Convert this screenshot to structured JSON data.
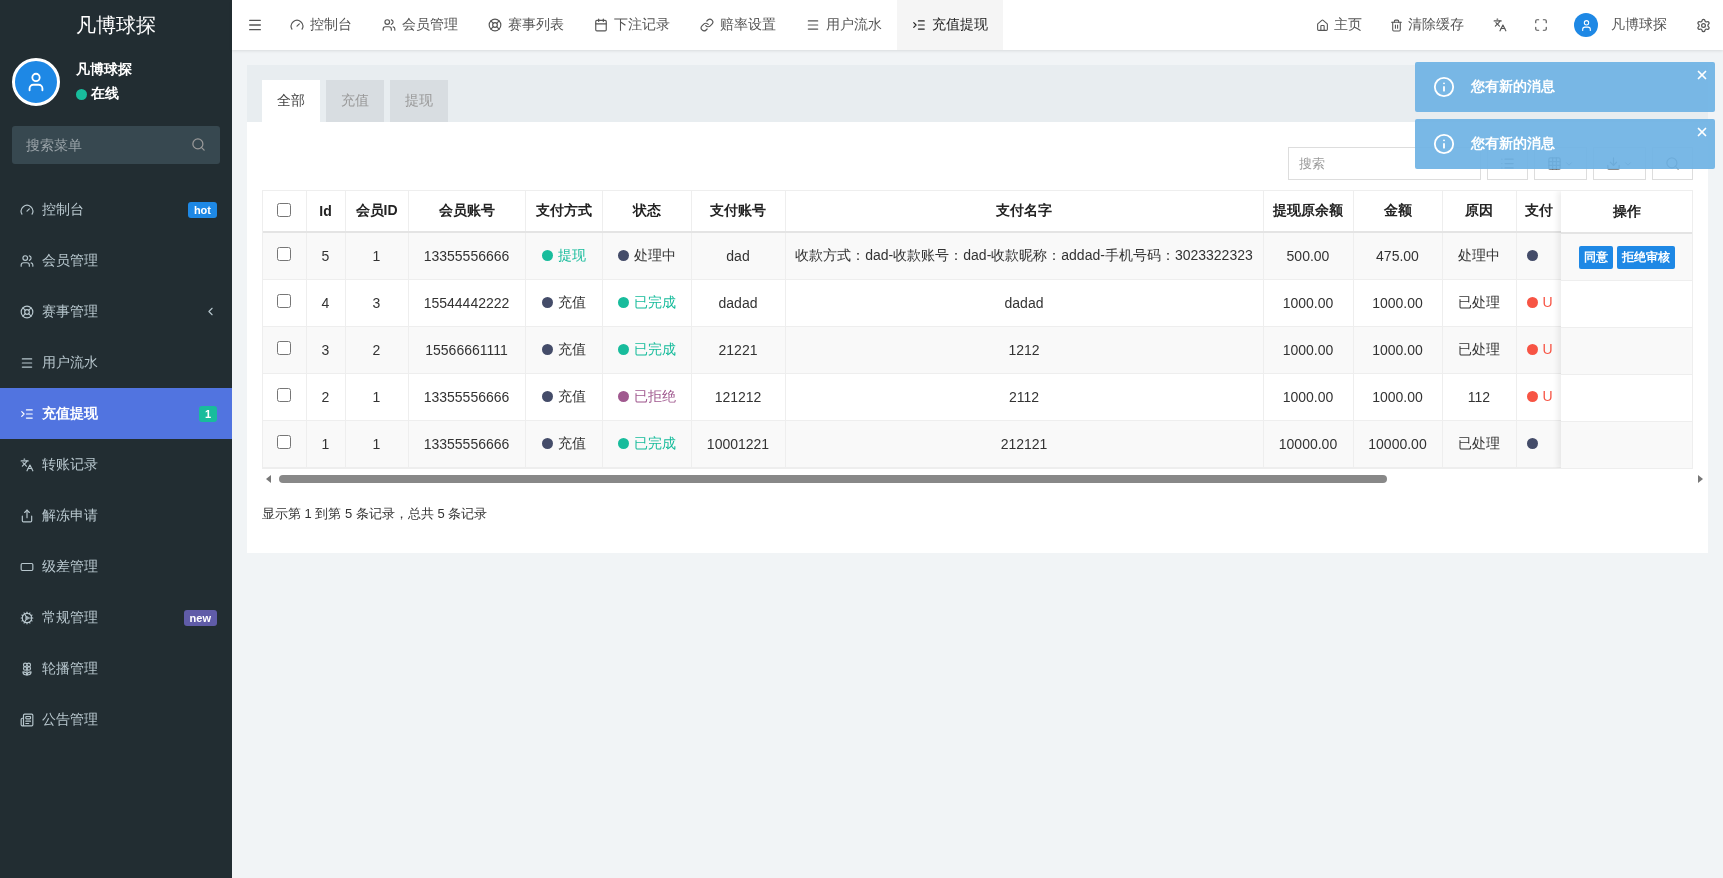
{
  "sidebar": {
    "brand": "凡博球探",
    "user": {
      "name": "凡博球探",
      "status": "在线",
      "online": true
    },
    "search": {
      "placeholder": "搜索菜单"
    },
    "items": [
      {
        "label": "控制台",
        "selected": false,
        "badge": {
          "text": "hot",
          "color": "#1e88e5"
        }
      },
      {
        "label": "会员管理",
        "selected": false
      },
      {
        "label": "赛事管理",
        "selected": false,
        "expanded": false
      },
      {
        "label": "用户流水",
        "selected": false
      },
      {
        "label": "充值提现",
        "selected": true,
        "badge": {
          "text": "1",
          "color": "#18bc9c"
        }
      },
      {
        "label": "转账记录",
        "selected": false
      },
      {
        "label": "解冻申请",
        "selected": false
      },
      {
        "label": "级差管理",
        "selected": false
      },
      {
        "label": "常规管理",
        "selected": false,
        "badge": {
          "text": "new",
          "color": "#605ca8"
        }
      },
      {
        "label": "轮播管理",
        "selected": false
      },
      {
        "label": "公告管理",
        "selected": false
      }
    ]
  },
  "topbar": {
    "tabs": [
      {
        "label": "控制台",
        "selected": false
      },
      {
        "label": "会员管理",
        "selected": false
      },
      {
        "label": "赛事列表",
        "selected": false
      },
      {
        "label": "下注记录",
        "selected": false
      },
      {
        "label": "赔率设置",
        "selected": false
      },
      {
        "label": "用户流水",
        "selected": false
      },
      {
        "label": "充值提现",
        "selected": true
      }
    ],
    "links": [
      "主页",
      "清除缓存"
    ],
    "user": "凡博球探"
  },
  "content": {
    "tabs": [
      {
        "label": "全部",
        "selected": true
      },
      {
        "label": "充值",
        "selected": false
      },
      {
        "label": "提现",
        "selected": false
      }
    ],
    "search": {
      "placeholder": "搜索"
    },
    "table": {
      "columns": [
        "Id",
        "会员ID",
        "会员账号",
        "支付方式",
        "状态",
        "支付账号",
        "支付名字",
        "提现原余额",
        "金额",
        "原因",
        "支付"
      ],
      "all_checked": false,
      "rows": [
        {
          "checked": false,
          "id": "5",
          "member_id": "1",
          "account": "13355556666",
          "method": {
            "text": "提现",
            "color": "#18bc9c"
          },
          "status": {
            "text": "处理中",
            "color": "#444c69"
          },
          "pay_account": "dad",
          "pay_name": "收款方式：dad-收款账号：dad-收款昵称：addad-手机号码：3023322323",
          "balance": "500.00",
          "amount": "475.00",
          "reason": "处理中",
          "pay": {
            "color": "#444c69"
          }
        },
        {
          "checked": false,
          "id": "4",
          "member_id": "3",
          "account": "15544442222",
          "method": {
            "text": "充值",
            "color": "#444c69"
          },
          "status": {
            "text": "已完成",
            "color": "#18bc9c"
          },
          "pay_account": "dadad",
          "pay_name": "dadad",
          "balance": "1000.00",
          "amount": "1000.00",
          "reason": "已处理",
          "pay": {
            "color": "#f75444",
            "text": "U"
          }
        },
        {
          "checked": false,
          "id": "3",
          "member_id": "2",
          "account": "15566661111",
          "method": {
            "text": "充值",
            "color": "#444c69"
          },
          "status": {
            "text": "已完成",
            "color": "#18bc9c"
          },
          "pay_account": "21221",
          "pay_name": "1212",
          "balance": "1000.00",
          "amount": "1000.00",
          "reason": "已处理",
          "pay": {
            "color": "#f75444",
            "text": "U"
          }
        },
        {
          "checked": false,
          "id": "2",
          "member_id": "1",
          "account": "13355556666",
          "method": {
            "text": "充值",
            "color": "#444c69"
          },
          "status": {
            "text": "已拒绝",
            "color": "#a0598f"
          },
          "pay_account": "121212",
          "pay_name": "2112",
          "balance": "1000.00",
          "amount": "1000.00",
          "reason": "112",
          "pay": {
            "color": "#f75444",
            "text": "U"
          }
        },
        {
          "checked": false,
          "id": "1",
          "member_id": "1",
          "account": "13355556666",
          "method": {
            "text": "充值",
            "color": "#444c69"
          },
          "status": {
            "text": "已完成",
            "color": "#18bc9c"
          },
          "pay_account": "10001221",
          "pay_name": "212121",
          "balance": "10000.00",
          "amount": "10000.00",
          "reason": "已处理",
          "pay": {
            "color": "#444c69"
          }
        }
      ]
    },
    "actions": {
      "title": "操作",
      "rows": [
        [
          "同意",
          "拒绝审核"
        ],
        [],
        [],
        [],
        []
      ]
    },
    "footer": "显示第 1 到第 5 条记录，总共 5 条记录"
  },
  "notifications": [
    "您有新的消息",
    "您有新的消息"
  ]
}
